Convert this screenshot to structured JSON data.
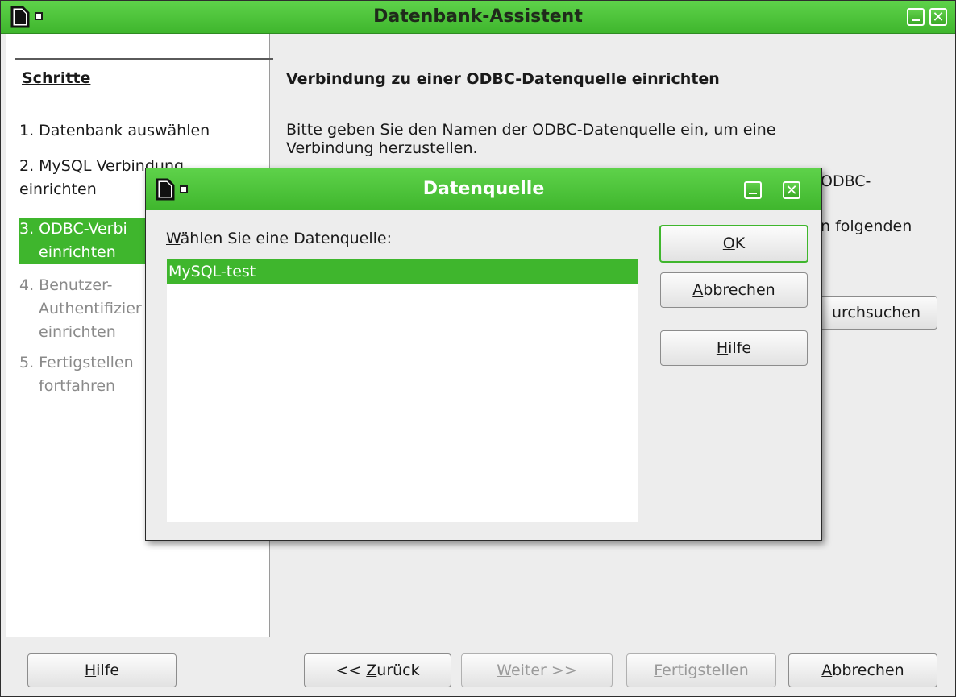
{
  "window": {
    "title": "Datenbank-Assistent"
  },
  "sidebar": {
    "heading": "Schritte",
    "steps": [
      {
        "line1": "1. Datenbank auswählen",
        "line2": ""
      },
      {
        "line1": "2. MySQL Verbindung",
        "line2": "einrichten"
      },
      {
        "line1": "3. ODBC-Verbi",
        "line2": "einrichten"
      },
      {
        "line1": "4. Benutzer-",
        "line2": "Authentifizier",
        "line3": "einrichten"
      },
      {
        "line1": "5. Fertigstellen",
        "line2": "fortfahren"
      }
    ]
  },
  "content": {
    "heading": "Verbindung zu einer ODBC-Datenquelle einrichten",
    "para_line1": "Bitte geben Sie den Namen der ODBC-Datenquelle ein, um eine",
    "para_line2": "Verbindung herzustellen.",
    "frag_odbc": "ODBC-",
    "frag_folgenden": "n folgenden",
    "browse_fragment": "urchsuchen"
  },
  "bottom": {
    "help_prefix": "",
    "help_accel": "H",
    "help_rest": "ilfe",
    "back_prefix": "<< ",
    "back_accel": "Z",
    "back_rest": "urück",
    "next_accel": "W",
    "next_rest": "eiter >>",
    "finish_accel": "F",
    "finish_rest": "ertigstellen",
    "cancel_accel": "A",
    "cancel_rest": "bbrechen"
  },
  "dialog": {
    "title": "Datenquelle",
    "label_accel": "W",
    "label_rest": "ählen Sie eine Datenquelle:",
    "items": [
      "MySQL-test"
    ],
    "ok_accel": "O",
    "ok_rest": "K",
    "cancel_accel": "A",
    "cancel_rest": "bbrechen",
    "help_accel": "H",
    "help_rest": "ilfe"
  }
}
